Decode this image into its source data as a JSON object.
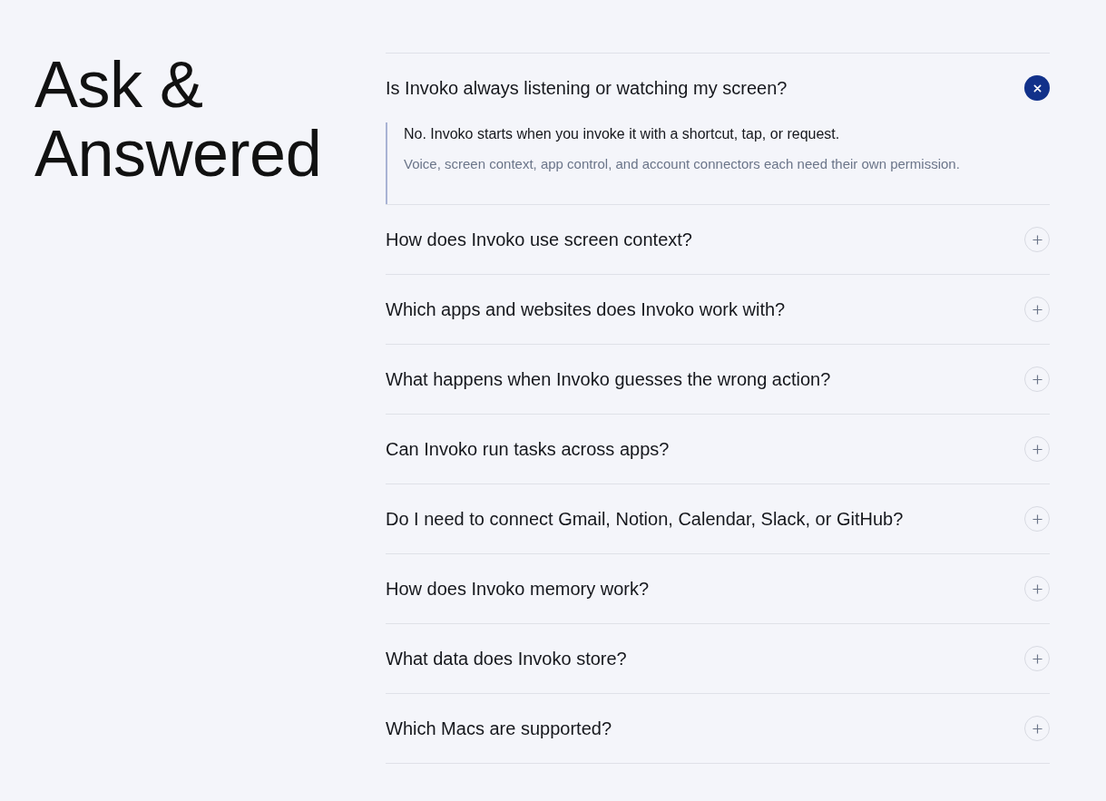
{
  "heading": "Ask & Answered",
  "faq": [
    {
      "question": "Is Invoko always listening or watching my screen?",
      "expanded": true,
      "answer": {
        "lead": "No. Invoko starts when you invoke it with a shortcut, tap, or request.",
        "detail": "Voice, screen context, app control, and account connectors each need their own permission."
      }
    },
    {
      "question": "How does Invoko use screen context?",
      "expanded": false
    },
    {
      "question": "Which apps and websites does Invoko work with?",
      "expanded": false
    },
    {
      "question": "What happens when Invoko guesses the wrong action?",
      "expanded": false
    },
    {
      "question": "Can Invoko run tasks across apps?",
      "expanded": false
    },
    {
      "question": "Do I need to connect Gmail, Notion, Calendar, Slack, or GitHub?",
      "expanded": false
    },
    {
      "question": "How does Invoko memory work?",
      "expanded": false
    },
    {
      "question": "What data does Invoko store?",
      "expanded": false
    },
    {
      "question": "Which Macs are supported?",
      "expanded": false
    }
  ]
}
